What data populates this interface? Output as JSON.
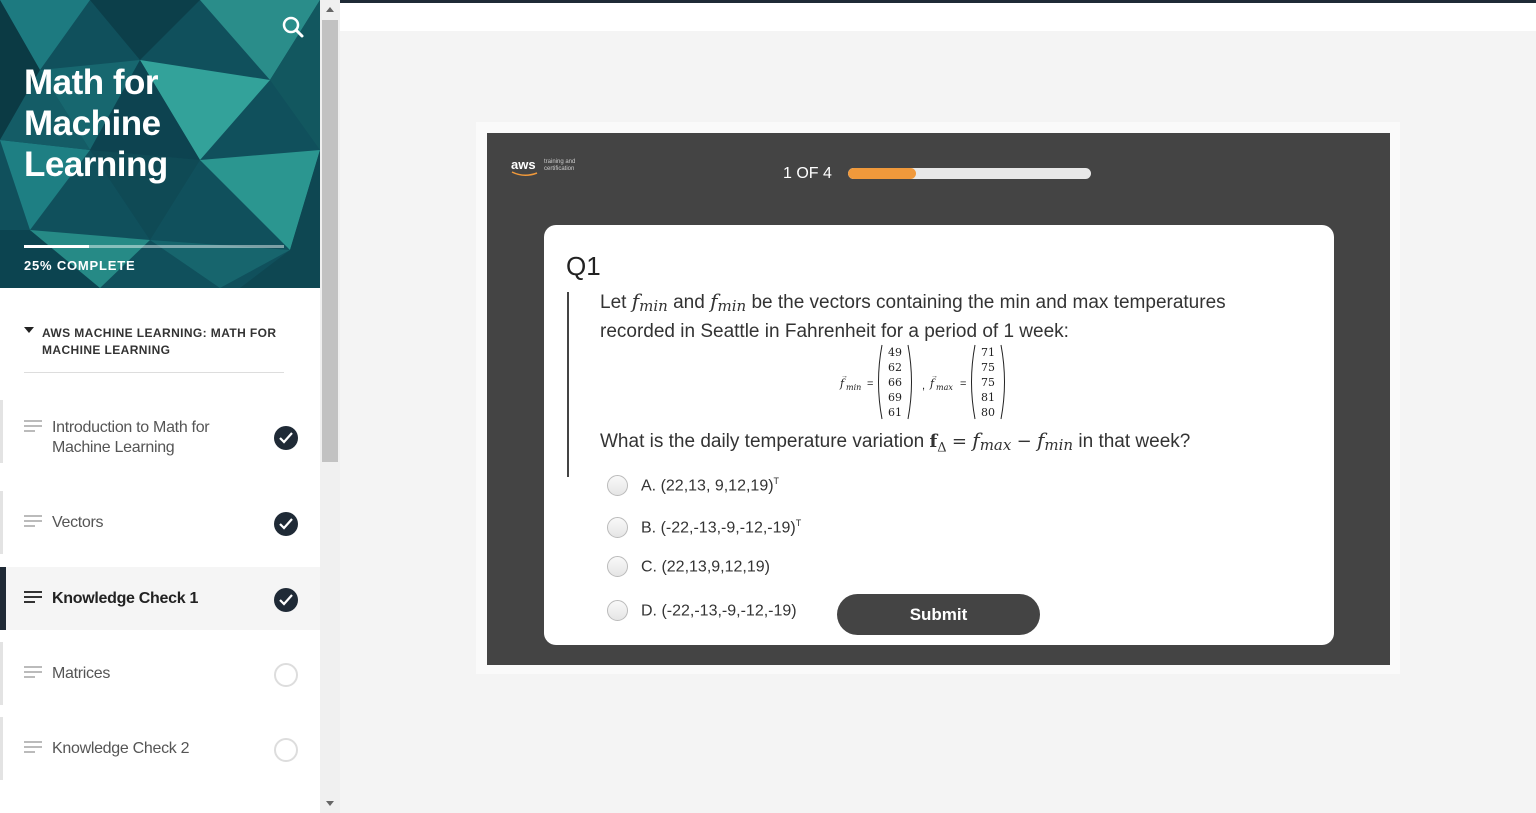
{
  "sidebar": {
    "course_title": "Math for Machine Learning",
    "progress_text": "25% COMPLETE",
    "progress_fraction": 0.25,
    "section_title": "AWS MACHINE LEARNING: MATH FOR MACHINE LEARNING",
    "lessons": [
      {
        "label": "Introduction to Math for Machine Learning",
        "status": "complete"
      },
      {
        "label": "Vectors",
        "status": "complete"
      },
      {
        "label": "Knowledge Check 1",
        "status": "complete",
        "active": true
      },
      {
        "label": "Matrices",
        "status": "incomplete"
      },
      {
        "label": "Knowledge Check 2",
        "status": "incomplete"
      }
    ]
  },
  "header": {
    "logo_text": "aws",
    "logo_subtext": "training and certification",
    "counter": "1 OF 4",
    "progress_fraction": 0.28
  },
  "question": {
    "number": "Q1",
    "text_intro": "Let",
    "var_a": "f",
    "var_a_sub": "min",
    "text_and": "and",
    "var_b": "f",
    "var_b_sub": "min",
    "text_rest": "be the vectors containing the min and max temperatures recorded in Seattle in Fahrenheit for a period of 1 week:",
    "fmin_values": [
      "49",
      "62",
      "66",
      "69",
      "61"
    ],
    "fmax_values": [
      "71",
      "75",
      "75",
      "81",
      "80"
    ],
    "fmin_label": "f",
    "fmin_sub": "min",
    "fmax_label": "f",
    "fmax_sub": "max",
    "prompt_lead": "What is the daily temperature variation",
    "formula_lhs": "f",
    "formula_lhs_sub": "Δ",
    "formula_eq": "=",
    "formula_t1": "f",
    "formula_t1_sub": "max",
    "formula_minus": "−",
    "formula_t2": "f",
    "formula_t2_sub": "min",
    "prompt_tail": "in that week?",
    "options": [
      {
        "letter": "A.",
        "text": "(22,13, 9,12,19)",
        "sup": "T"
      },
      {
        "letter": "B.",
        "text": "(-22,-13,-9,-12,-19)",
        "sup": "T"
      },
      {
        "letter": "C.",
        "text": "(22,13,9,12,19)",
        "sup": ""
      },
      {
        "letter": "D.",
        "text": "(-22,-13,-9,-12,-19)",
        "sup": ""
      }
    ],
    "submit_label": "Submit"
  }
}
